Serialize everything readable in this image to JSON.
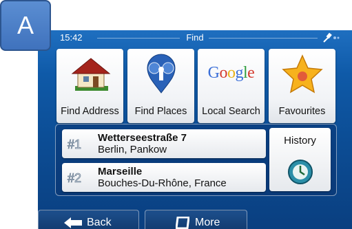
{
  "status": {
    "time": "15:42",
    "title": "Find"
  },
  "badge": {
    "letter": "A"
  },
  "tiles": [
    {
      "label": "Find Address",
      "icon": "house-icon"
    },
    {
      "label": "Find Places",
      "icon": "places-icon"
    },
    {
      "label": "Local Search",
      "icon": "google-logo",
      "logo_text": "Google"
    },
    {
      "label": "Favourites",
      "icon": "star-icon"
    }
  ],
  "recent": [
    {
      "rank": "#1",
      "name": "Wetterseestraße 7",
      "detail": "Berlin, Pankow"
    },
    {
      "rank": "#2",
      "name": "Marseille",
      "detail": "Bouches-Du-Rhône, France"
    }
  ],
  "history": {
    "label": "History",
    "icon": "history-clock-icon"
  },
  "bottom": {
    "back_label": "Back",
    "more_label": "More"
  },
  "colors": {
    "background": "#0c4d95",
    "tile": "#f1f3f6",
    "badge": "#4a7dc6"
  }
}
